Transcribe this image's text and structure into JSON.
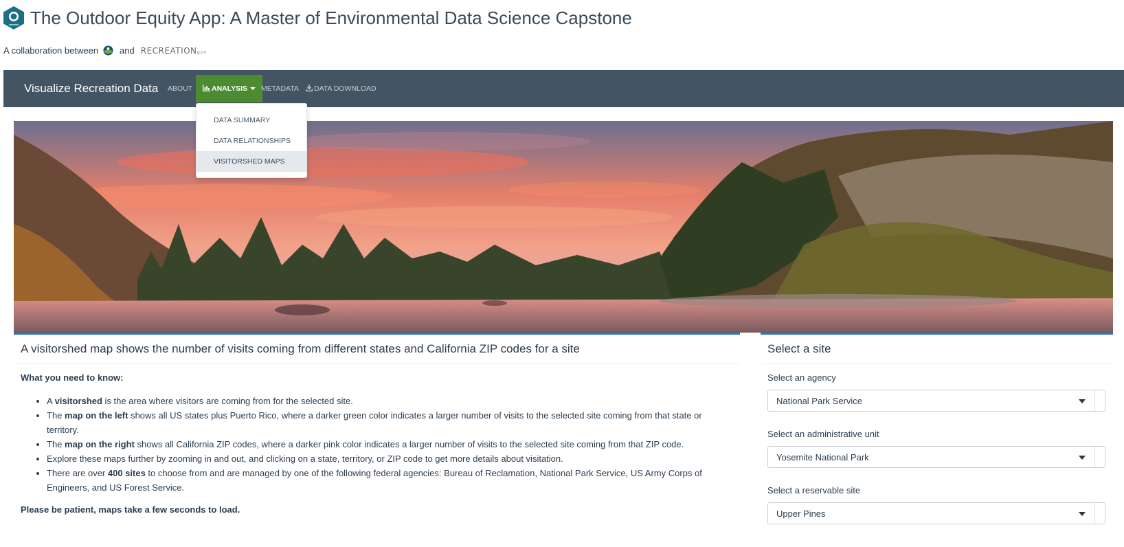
{
  "header": {
    "title": "The Outdoor Equity App: A Master of Environmental Data Science Capstone",
    "collab_prefix": "A collaboration between",
    "collab_and": "and",
    "recreation_logo": "RECREATION",
    "recreation_logo_suffix": "gov"
  },
  "navbar": {
    "brand": "Visualize Recreation Data",
    "items": [
      {
        "label": "ABOUT"
      },
      {
        "label": "ANALYSIS",
        "icon": "bar-chart-icon"
      },
      {
        "label": "METADATA"
      },
      {
        "label": "DATA DOWNLOAD",
        "icon": "download-icon"
      }
    ]
  },
  "dropdown": {
    "items": [
      {
        "label": "DATA SUMMARY"
      },
      {
        "label": "DATA RELATIONSHIPS"
      },
      {
        "label": "VISITORSHED MAPS"
      }
    ]
  },
  "main": {
    "title": "A visitorshed map shows the number of visits coming from different states and California ZIP codes for a site",
    "need_heading": "What you need to know:",
    "bullets": [
      {
        "pre": "A ",
        "bold": "visitorshed",
        "post": " is the area where visitors are coming from for the selected site."
      },
      {
        "pre": "The ",
        "bold": "map on the left",
        "post": " shows all US states plus Puerto Rico, where a darker green color indicates a larger number of visits to the selected site coming from that state or territory."
      },
      {
        "pre": "The ",
        "bold": "map on the right",
        "post": " shows all California ZIP codes, where a darker pink color indicates a larger number of visits to the selected site coming from that ZIP code."
      },
      {
        "pre": "",
        "bold": "",
        "post": "Explore these maps further by zooming in and out, and clicking on a state, territory, or ZIP code to get more details about visitation."
      },
      {
        "pre": "There are over ",
        "bold": "400 sites",
        "post": " to choose from and are managed by one of the following federal agencies: Bureau of Reclamation, National Park Service, US Army Corps of Engineers, and US Forest Service."
      }
    ],
    "patient": "Please be patient, maps take a few seconds to load."
  },
  "sidebar": {
    "title": "Select a site",
    "agency_label": "Select an agency",
    "agency_value": "National Park Service",
    "unit_label": "Select an administrative unit",
    "unit_value": "Yosemite National Park",
    "site_label": "Select a reservable site",
    "site_value": "Upper Pines"
  },
  "colors": {
    "navbar": "#435563",
    "active_tab": "#4d8b33",
    "card_border": "#2a7bb8",
    "title_text": "#3a4a58"
  }
}
